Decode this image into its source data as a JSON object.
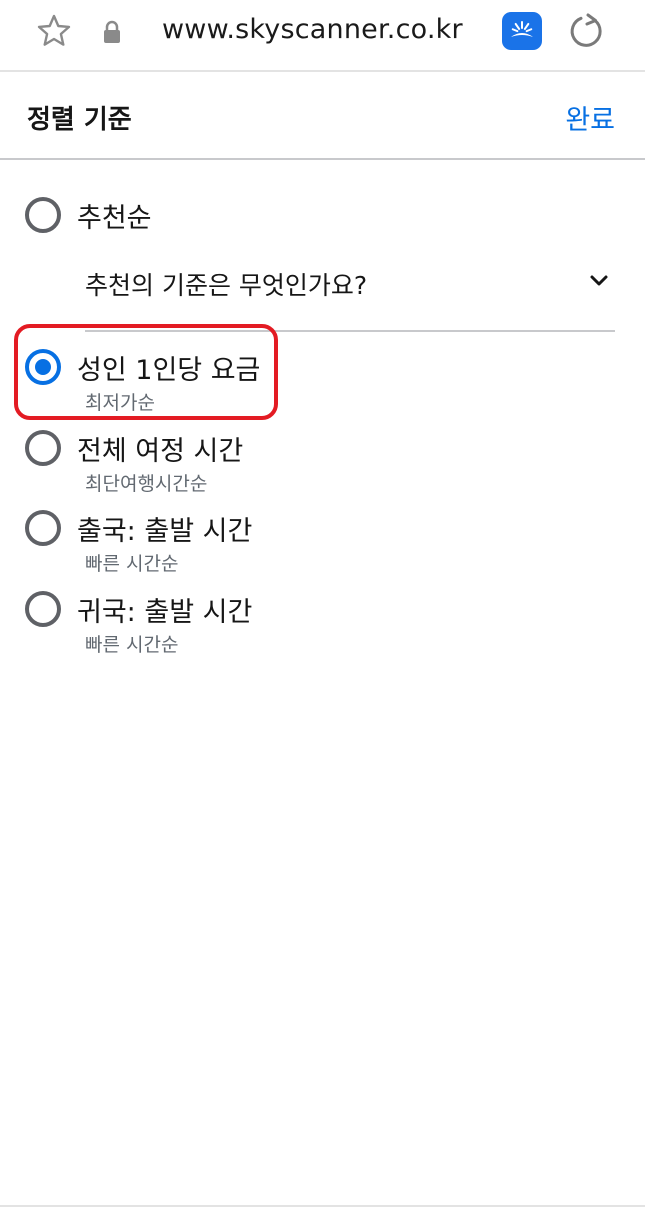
{
  "browser": {
    "url": "www.skyscanner.co.kr"
  },
  "sort": {
    "title": "정렬 기준",
    "done_label": "완료",
    "explain_text": "추천의 기준은 무엇인가요?",
    "options": [
      {
        "label": "추천순",
        "sub": "",
        "selected": false
      },
      {
        "label": "성인 1인당 요금",
        "sub": "최저가순",
        "selected": true
      },
      {
        "label": "전체 여정 시간",
        "sub": "최단여행시간순",
        "selected": false
      },
      {
        "label": "출국: 출발 시간",
        "sub": "빠른 시간순",
        "selected": false
      },
      {
        "label": "귀국: 출발 시간",
        "sub": "빠른 시간순",
        "selected": false
      }
    ]
  },
  "colors": {
    "accent": "#0770e3",
    "highlight": "#e31b23"
  },
  "icons": {
    "bookmark": "star-icon",
    "security": "lock-icon",
    "extension": "skyscanner-logo-icon",
    "reload": "reload-icon",
    "expand": "chevron-down-icon"
  }
}
